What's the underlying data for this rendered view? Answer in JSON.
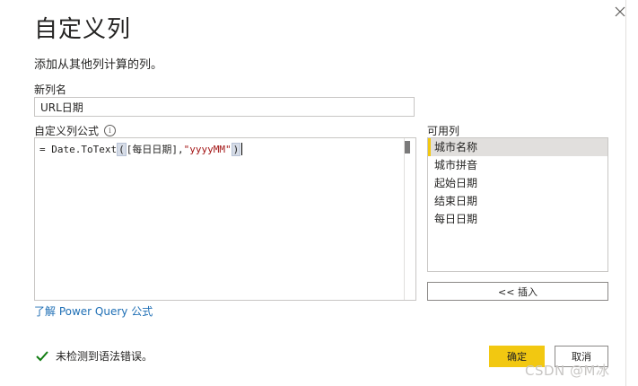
{
  "dialog": {
    "title": "自定义列",
    "subtitle": "添加从其他列计算的列。"
  },
  "new_column": {
    "label": "新列名",
    "value": "URL日期"
  },
  "formula": {
    "label": "自定义列公式",
    "info_icon": "info-icon",
    "tokens": {
      "eq": "= ",
      "fn": "Date.ToText",
      "open": "(",
      "ref": "[每日日期],",
      "str": "\"yyyyMM\"",
      "close": ")"
    }
  },
  "available_columns": {
    "label": "可用列",
    "items": [
      "城市名称",
      "城市拼音",
      "起始日期",
      "结束日期",
      "每日日期"
    ],
    "selected": "城市名称"
  },
  "insert_button": "<< 插入",
  "learn_link": "了解 Power Query 公式",
  "status": {
    "icon": "check-icon",
    "text": "未检测到语法错误。",
    "color": "#107c10"
  },
  "buttons": {
    "ok": "确定",
    "cancel": "取消"
  },
  "accent_color": "#f2c811",
  "watermark": "CSDN @M冰"
}
